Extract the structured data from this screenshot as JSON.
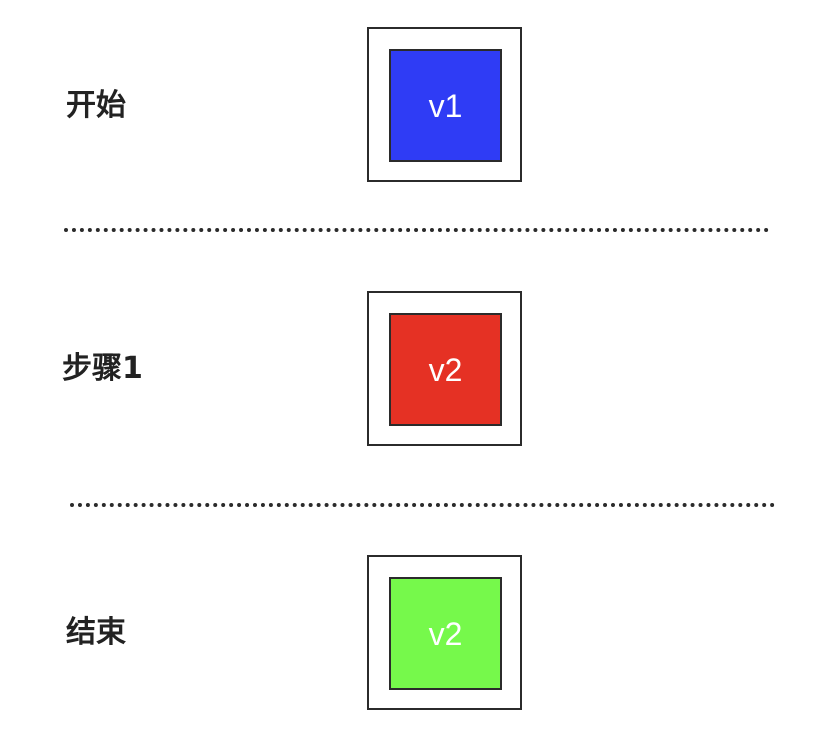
{
  "stages": [
    {
      "label": "开始",
      "value": "v1",
      "color": "#2f3cf5"
    },
    {
      "label": "步骤1",
      "value": "v2",
      "color": "#e53124"
    },
    {
      "label": "结束",
      "value": "v2",
      "color": "#76f94b"
    }
  ]
}
